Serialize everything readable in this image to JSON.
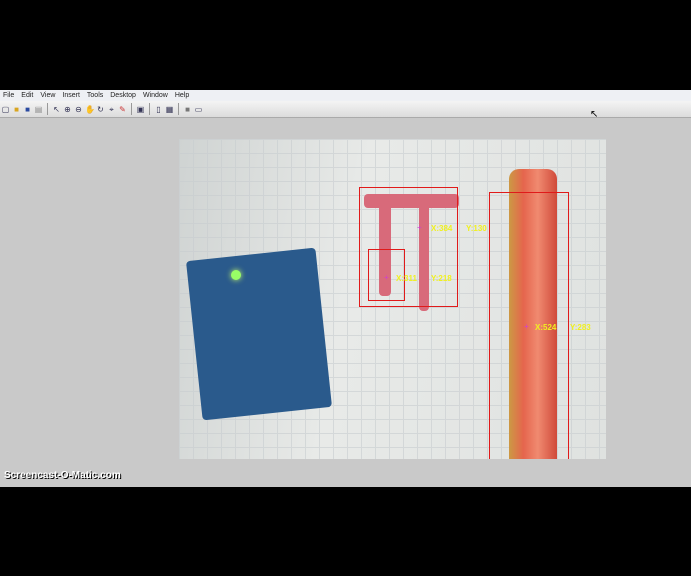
{
  "menu": [
    "File",
    "Edit",
    "View",
    "Insert",
    "Tools",
    "Desktop",
    "Window",
    "Help"
  ],
  "toolbar": [
    "new-icon",
    "open-icon",
    "save-icon",
    "print-icon",
    "pointer-icon",
    "zoom-in-icon",
    "zoom-out-icon",
    "pan-icon",
    "rotate-icon",
    "data-cursor-icon",
    "brush-icon",
    "link-plot-icon",
    "colorbar-icon",
    "legend-icon",
    "hide-plot-tools-icon",
    "show-plot-tools-icon"
  ],
  "detections": [
    {
      "x_label": "X:384",
      "y_label": "Y:130"
    },
    {
      "x_label": "X:311",
      "y_label": "Y:218"
    },
    {
      "x_label": "X:524",
      "y_label": "Y:283"
    }
  ],
  "watermark": "Screencast-O-Matic.com"
}
